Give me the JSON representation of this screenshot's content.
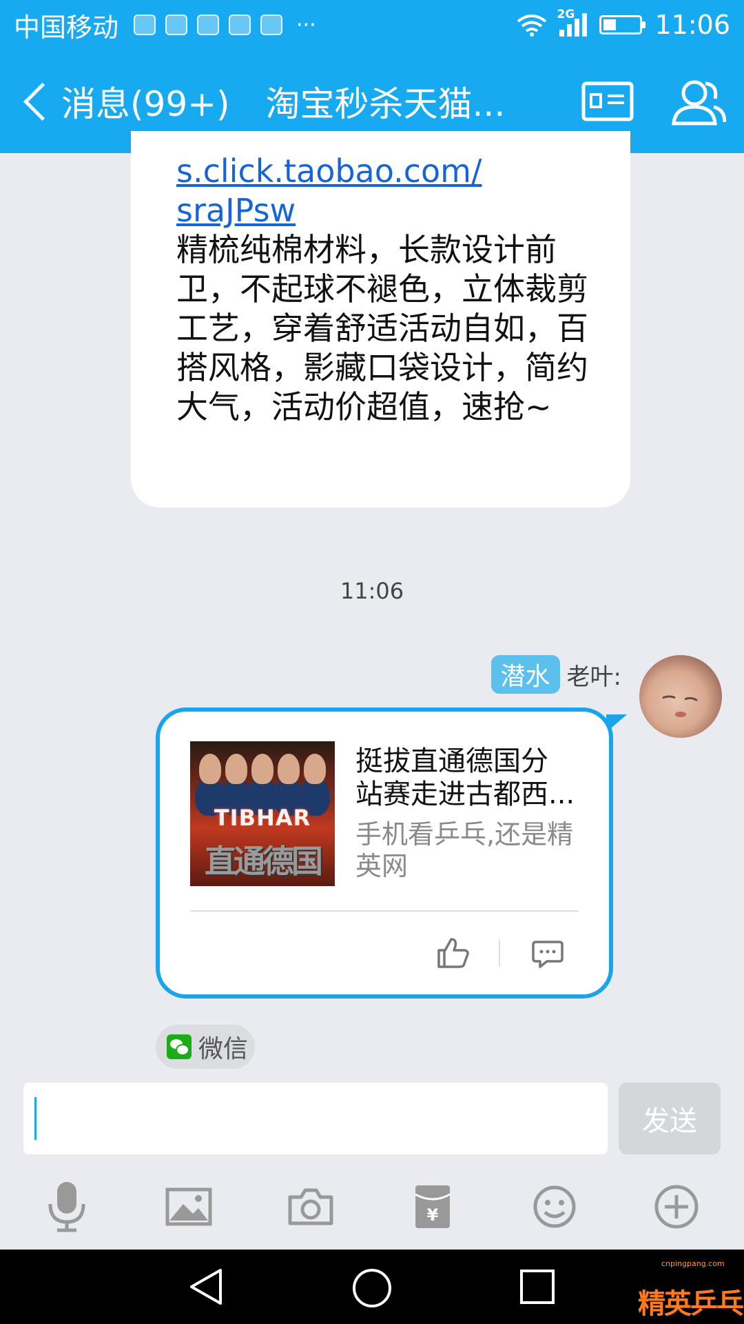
{
  "status_bar": {
    "carrier": "中国移动",
    "network": "2G",
    "time": "11:06",
    "overflow": "···",
    "icons": [
      "app-notification-icon",
      "mail-icon",
      "health-icon",
      "gallery-icon",
      "photo-icon"
    ]
  },
  "header": {
    "back_label": "消息(99+)",
    "chat_title": "淘宝秒杀天猫...",
    "icons": [
      "profile-card-icon",
      "group-members-icon"
    ]
  },
  "messages": {
    "top_bubble": {
      "link_line1": "s.click.taobao.com/",
      "link_line2": "sraJPsw",
      "text": "精梳纯棉材料，长款设计前卫，不起球不褪色，立体裁剪工艺，穿着舒适活动自如，百搭风格，影藏口袋设计，简约大气，活动价超值，速抢~"
    },
    "timestamp": "11:06",
    "sender": {
      "badge": "潜水",
      "name": "老叶:"
    },
    "card": {
      "image_brand": "TIBHAR",
      "image_title": "直通德国",
      "title_line1": "挺拔直通德国分",
      "title_line2": "站赛走进古都西...",
      "subtitle": "手机看乒乓,还是精英网"
    },
    "source_chip": "微信"
  },
  "input": {
    "value": "",
    "send_label": "发送"
  },
  "toolbar": [
    "microphone-icon",
    "image-icon",
    "camera-icon",
    "red-packet-icon",
    "emoji-icon",
    "plus-icon"
  ],
  "navbar": [
    "back-triangle-icon",
    "home-circle-icon",
    "recents-square-icon"
  ],
  "watermark": {
    "text": "精英乒乓网",
    "url": "cnpingpang.com"
  },
  "colors": {
    "accent": "#18aaf0",
    "card_border": "#1aa5ea",
    "link": "#1565d8",
    "chat_background": "#e9ebf0"
  }
}
